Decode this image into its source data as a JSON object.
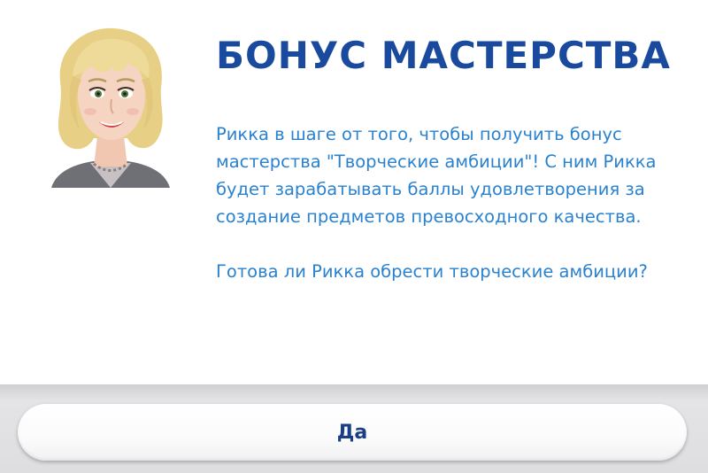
{
  "dialog": {
    "title": "БОНУС МАСТЕРСТВА",
    "paragraphs": [
      "Рикка в шаге от того, чтобы получить бонус мастерства \"Творческие амбиции\"! С ним Рикка будет зарабатывать баллы удовлетворения за создание предметов превосходного качества.",
      "Готова ли Рикка обрести творческие амбиции?"
    ],
    "confirm_label": "Да"
  },
  "colors": {
    "title": "#1a4a9e",
    "body_text": "#2a82cf",
    "button_text": "#1a3f86",
    "panel": "#ffffff",
    "footer": "#dedee0"
  }
}
